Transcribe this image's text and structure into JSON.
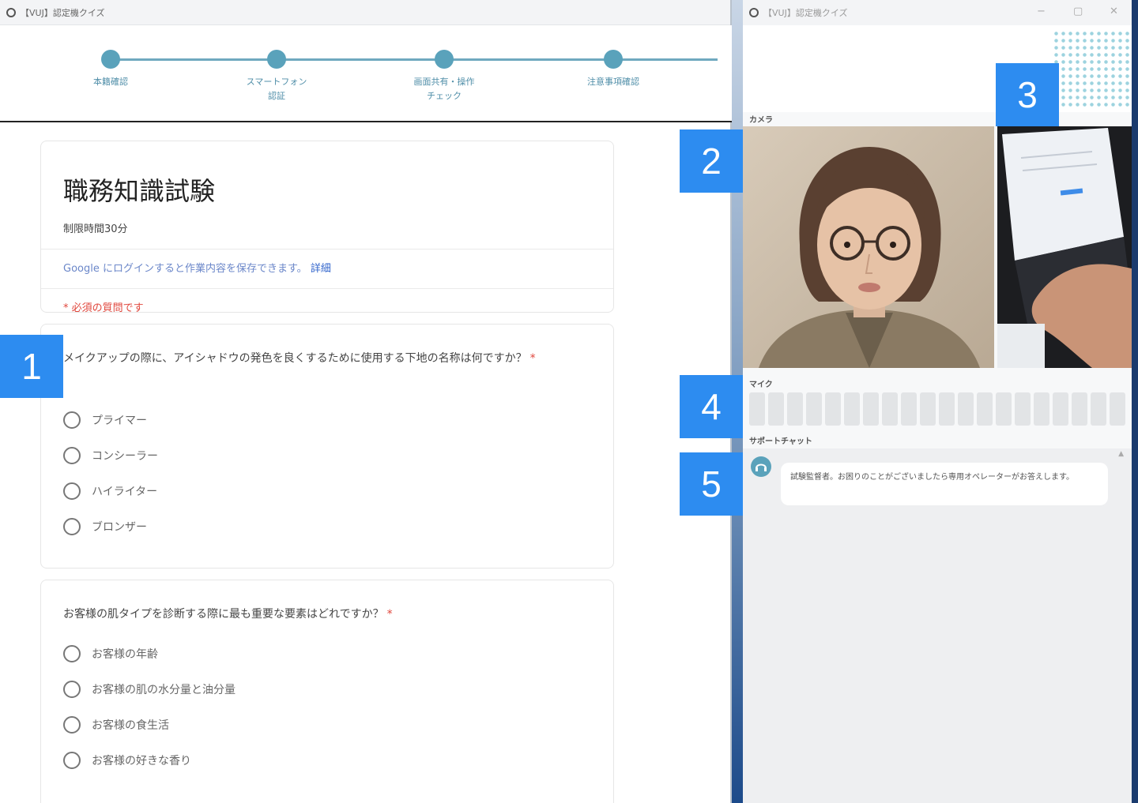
{
  "left_window": {
    "title": "【VUJ】認定機クイズ",
    "steps": [
      {
        "label": "本籍確認"
      },
      {
        "label": "スマートフォン\n認証"
      },
      {
        "label": "画面共有・操作\nチェック"
      },
      {
        "label": "注意事項確認"
      }
    ],
    "form": {
      "title": "職務知識試験",
      "time_limit": "制限時間30分",
      "login_note": "Google にログインすると作業内容を保存できます。",
      "login_link": "詳細",
      "required_note": "* 必須の質問です",
      "questions": [
        {
          "text": "メイクアップの際に、アイシャドウの発色を良くするために使用する下地の名称は何ですか？",
          "required": "*",
          "options": [
            "プライマー",
            "コンシーラー",
            "ハイライター",
            "ブロンザー"
          ]
        },
        {
          "text": "お客様の肌タイプを診断する際に最も重要な要素はどれですか？",
          "required": "*",
          "options": [
            "お客様の年齢",
            "お客様の肌の水分量と油分量",
            "お客様の食生活",
            "お客様の好きな香り"
          ]
        }
      ]
    }
  },
  "right_window": {
    "title": "【VUJ】認定機クイズ",
    "controls": {
      "minimize": "−",
      "maximize": "▢",
      "close": "✕"
    },
    "camera_label": "カメラ",
    "mic_label": "マイク",
    "chat_label": "サポートチャット",
    "chat_message": "試験監督者。お困りのことがございましたら専用オペレーターがお答えします。",
    "scroll_arrow": "▲"
  },
  "callouts": [
    "1",
    "2",
    "3",
    "4",
    "5"
  ],
  "colors": {
    "accent_step": "#5aa2bb",
    "callout": "#2d8cf0",
    "required": "#e0463c",
    "link": "#3366cc"
  }
}
